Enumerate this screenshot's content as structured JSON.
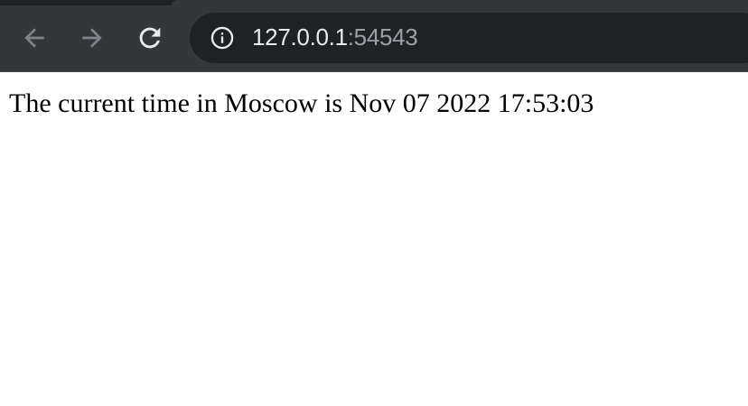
{
  "browser": {
    "colors": {
      "toolbar": "#35363a",
      "omnibox": "#202124",
      "icon": "#9aa0a6",
      "icon_active": "#e8eaed",
      "url_host": "#e8eaed",
      "url_port": "#9aa0a6"
    },
    "nav": {
      "back_icon": "arrow-left",
      "forward_icon": "arrow-right",
      "reload_icon": "reload"
    },
    "address_bar": {
      "site_info_icon": "info-circle",
      "host": "127.0.0.1",
      "port": ":54543"
    }
  },
  "page": {
    "text": "The current time in Moscow is Nov 07 2022 17:53:03"
  }
}
